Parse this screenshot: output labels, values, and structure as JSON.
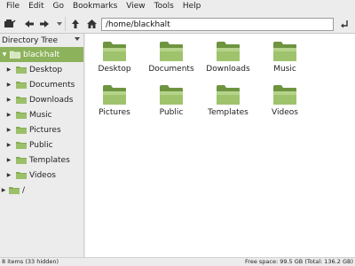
{
  "menu": [
    "File",
    "Edit",
    "Go",
    "Bookmarks",
    "View",
    "Tools",
    "Help"
  ],
  "toolbar": {
    "path": "/home/blackhalt",
    "icons": [
      "new-tab-icon",
      "back-icon",
      "forward-icon",
      "history-dropdown-icon",
      "up-icon",
      "home-icon",
      "go-icon"
    ]
  },
  "sidepane": {
    "title": "Directory Tree",
    "tree": [
      {
        "label": "blackhalt",
        "expanded": true,
        "selected": true
      },
      {
        "label": "Desktop"
      },
      {
        "label": "Documents"
      },
      {
        "label": "Downloads"
      },
      {
        "label": "Music"
      },
      {
        "label": "Pictures"
      },
      {
        "label": "Public"
      },
      {
        "label": "Templates"
      },
      {
        "label": "Videos"
      },
      {
        "label": "/"
      }
    ]
  },
  "files": [
    {
      "name": "Desktop"
    },
    {
      "name": "Documents"
    },
    {
      "name": "Downloads"
    },
    {
      "name": "Music"
    },
    {
      "name": "Pictures"
    },
    {
      "name": "Public"
    },
    {
      "name": "Templates"
    },
    {
      "name": "Videos"
    }
  ],
  "status": {
    "left": "8 items (33 hidden)",
    "right": "Free space: 99.5 GB (Total: 136.2 GB)"
  },
  "colors": {
    "accent": "#8cb25b",
    "folder_light": "#a7c57a",
    "folder_dark": "#6e9440"
  }
}
